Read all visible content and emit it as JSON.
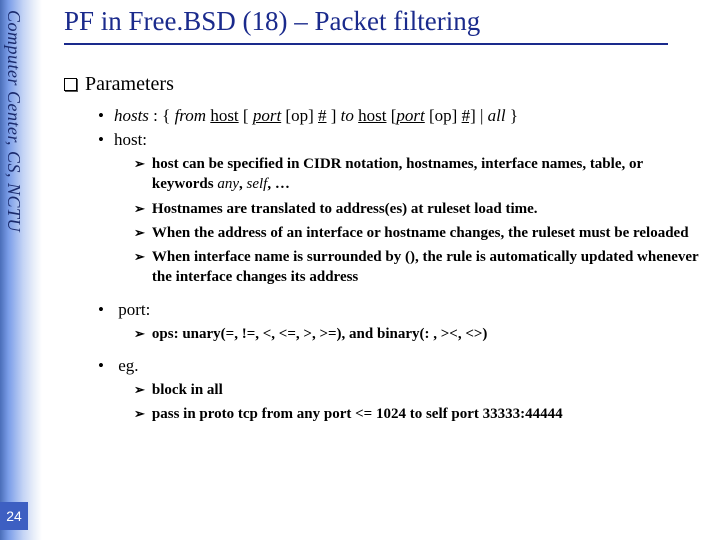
{
  "sidebar": {
    "label": "Computer Center, CS, NCTU",
    "page_number": "24"
  },
  "title": "PF in Free.BSD (18) – Packet filtering",
  "section_heading": "Parameters",
  "bullets": {
    "hosts_label": "hosts",
    "hosts_sep": " : { ",
    "hosts_from": "from",
    "hosts_host1": "host",
    "hosts_lb1": " [ ",
    "hosts_port1": "port",
    "hosts_sp1": " [op] ",
    "hosts_hash1": "#",
    "hosts_rb1": " ] ",
    "hosts_to": "to",
    "hosts_sp2": " ",
    "hosts_host2": "host",
    "hosts_lb2": " [",
    "hosts_port2": "port",
    "hosts_sp3": " [op] ",
    "hosts_hash2": "#]",
    "hosts_pipe": " | ",
    "hosts_all": "all",
    "hosts_end": " }",
    "host_label": "host:",
    "port_label": "port:",
    "eg_label": "eg."
  },
  "sub": {
    "host1a": "host can be specified in CIDR notation, hostnames, interface names, table, or keywords ",
    "host1b": "any",
    "host1c": ", ",
    "host1d": "self",
    "host1e": ", …",
    "host2": "Hostnames are translated to address(es) at ruleset load time.",
    "host3": "When the address of an interface or hostname changes, the ruleset must be reloaded",
    "host4": "When interface name is surrounded by (), the rule is automatically updated whenever the interface changes its address",
    "port1": "ops: unary(=, !=, <, <=, >, >=), and binary(: , ><, <>)",
    "eg1": "block in all",
    "eg2": "pass in proto tcp from any port <= 1024 to self port 33333:44444"
  }
}
